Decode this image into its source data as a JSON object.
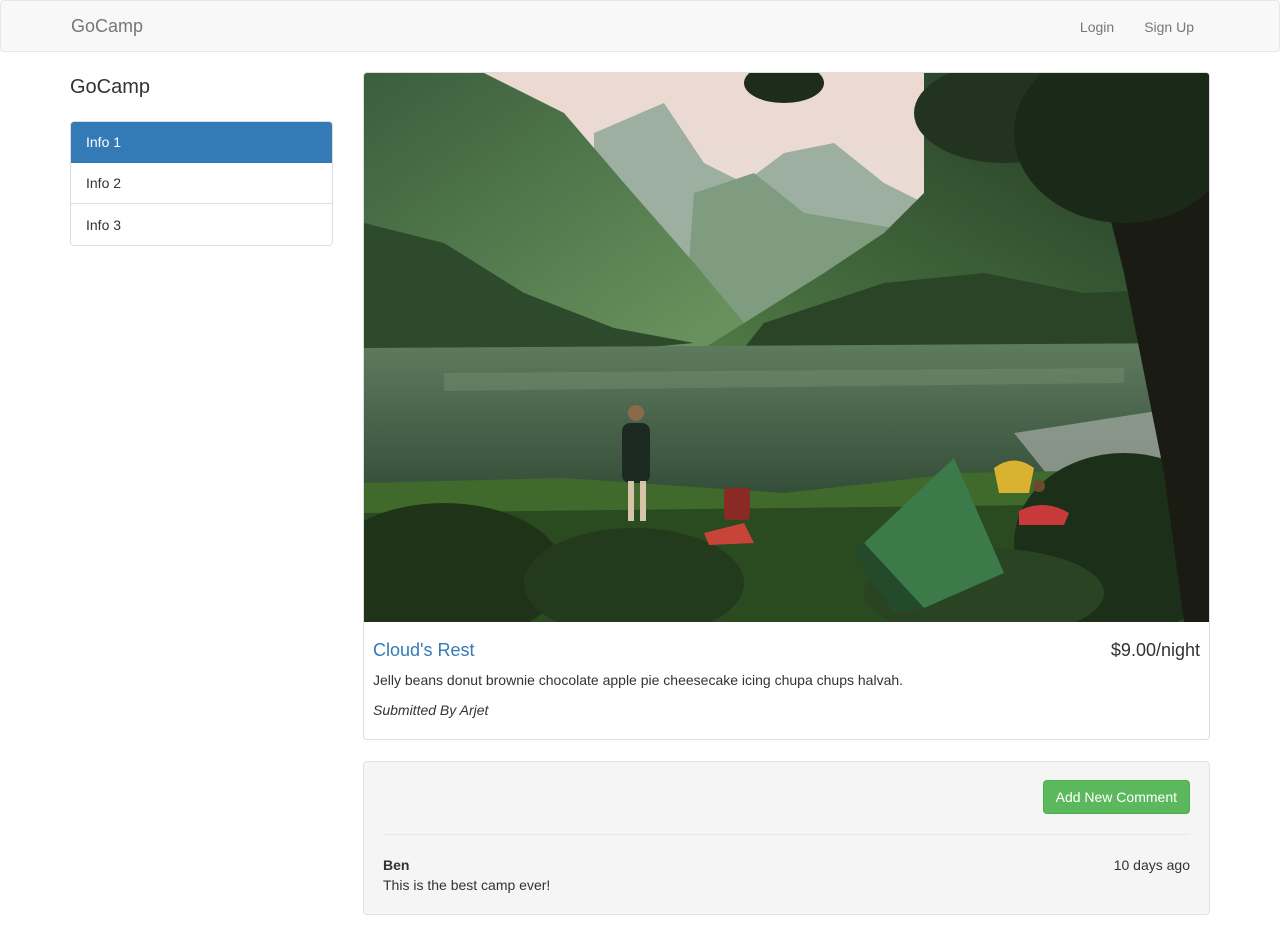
{
  "navbar": {
    "brand": "GoCamp",
    "links": [
      "Login",
      "Sign Up"
    ]
  },
  "sidebar": {
    "title": "GoCamp",
    "items": [
      {
        "label": "Info 1",
        "active": true
      },
      {
        "label": "Info 2",
        "active": false
      },
      {
        "label": "Info 3",
        "active": false
      }
    ]
  },
  "campground": {
    "image_alt": "Campers with a green tent beside a mountain lake",
    "name": "Cloud's Rest",
    "price": "$9.00/night",
    "description": "Jelly beans donut brownie chocolate apple pie cheesecake icing chupa chups halvah.",
    "submitted_by": "Submitted By Arjet"
  },
  "comments": {
    "add_button": "Add New Comment",
    "items": [
      {
        "author": "Ben",
        "date": "10 days ago",
        "text": "This is the best camp ever!"
      }
    ]
  },
  "colors": {
    "primary": "#337ab7",
    "success": "#5cb85c",
    "navbar_bg": "#f8f8f8",
    "well_bg": "#f5f5f5"
  }
}
